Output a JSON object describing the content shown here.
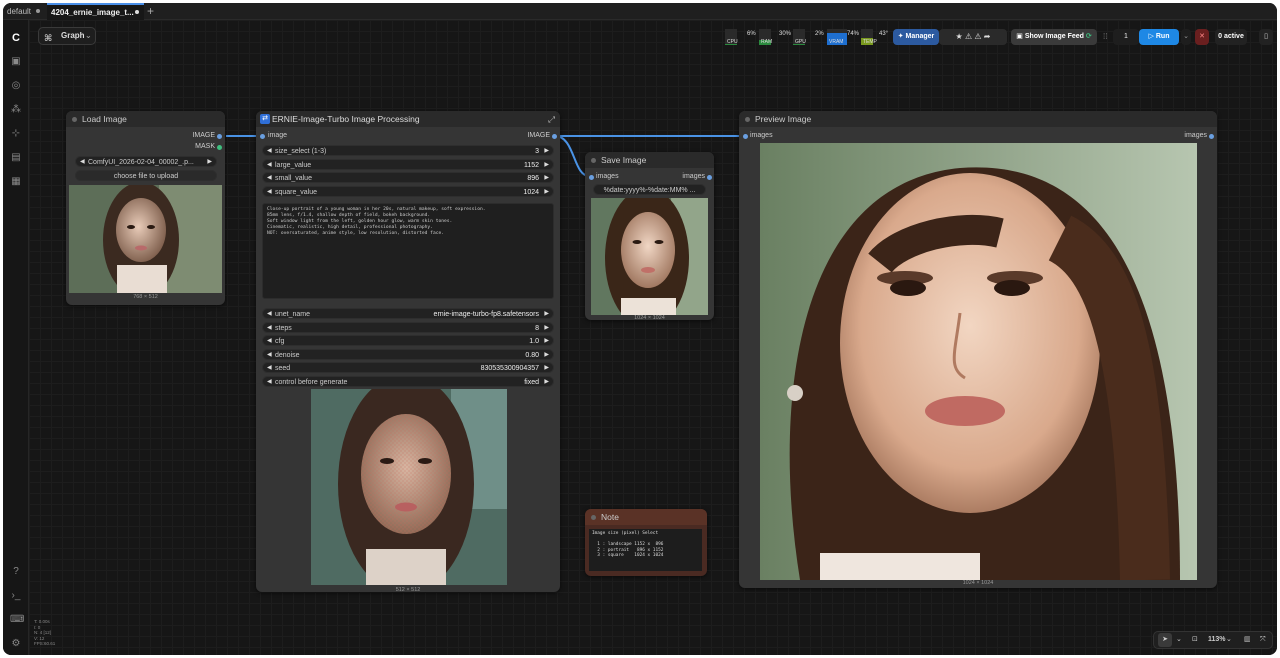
{
  "tabs": [
    {
      "label": "default"
    },
    {
      "label": "4204_ernie_image_t..."
    }
  ],
  "toolbar": {
    "graph_label": "Graph",
    "manager_label": "Manager",
    "image_feed_label": "Show Image Feed",
    "queue_count": "1",
    "run_label": "Run",
    "active_label": "0 active"
  },
  "monitors": [
    {
      "label": "CPU",
      "value": "6%",
      "level": 0.06
    },
    {
      "label": "RAM",
      "value": "30%",
      "level": 0.3
    },
    {
      "label": "GPU",
      "value": "2%",
      "level": 0.02
    },
    {
      "label": "VRAM",
      "value": "74%",
      "level": 0.74
    },
    {
      "label": "TEMP",
      "value": "43°",
      "level": 0.43
    }
  ],
  "load_image": {
    "title": "Load Image",
    "out_image": "IMAGE",
    "out_mask": "MASK",
    "file": "ComfyUI_2026-02-04_00002_.p...",
    "upload_label": "choose file to upload",
    "dims": "768 × 512"
  },
  "ernie": {
    "title": "ERNIE-Image-Turbo Image Processing",
    "in_image": "image",
    "out_image": "IMAGE",
    "widgets": [
      {
        "label": "size_select (1-3)",
        "value": "3"
      },
      {
        "label": "large_value",
        "value": "1152"
      },
      {
        "label": "small_value",
        "value": "896"
      },
      {
        "label": "square_value",
        "value": "1024"
      }
    ],
    "prompt": "Close-up portrait of a young woman in her 20s, natural makeup, soft expression.\n85mm lens, f/1.4, shallow depth of field, bokeh background.\nSoft window light from the left, golden hour glow, warm skin tones.\nCinematic, realistic, high detail, professional photography.\nNOT: oversaturated, anime style, low resolution, distorted face.",
    "widgets2": [
      {
        "label": "unet_name",
        "value": "ernie-image-turbo-fp8.safetensors"
      },
      {
        "label": "steps",
        "value": "8"
      },
      {
        "label": "cfg",
        "value": "1.0"
      },
      {
        "label": "denoise",
        "value": "0.80"
      },
      {
        "label": "seed",
        "value": "830535300904357"
      },
      {
        "label": "control before generate",
        "value": "fixed"
      }
    ],
    "dims": "512 × 512"
  },
  "save_image": {
    "title": "Save Image",
    "in_label": "images",
    "out_label": "images",
    "prefix": "%date:yyyy%-%date:MM% ...",
    "dims": "1024 × 1024"
  },
  "note": {
    "title": "Note",
    "text": "Image size (pixel) Select\n\n  1 : landscape 1152 x  896\n  2 : portrait   896 x 1152\n  3 : square    1024 x 1024"
  },
  "preview": {
    "title": "Preview Image",
    "in_label": "images",
    "out_label": "images",
    "dims": "1024 × 1024"
  },
  "stats": {
    "lines": [
      "T: 0.00s",
      "I: 0",
      "N: 4 [12]",
      "V: 12",
      "FPS:60.61"
    ]
  },
  "bottom": {
    "zoom": "113%"
  },
  "colors": {
    "accent": "#4a93e6",
    "run": "#1e88e5"
  }
}
